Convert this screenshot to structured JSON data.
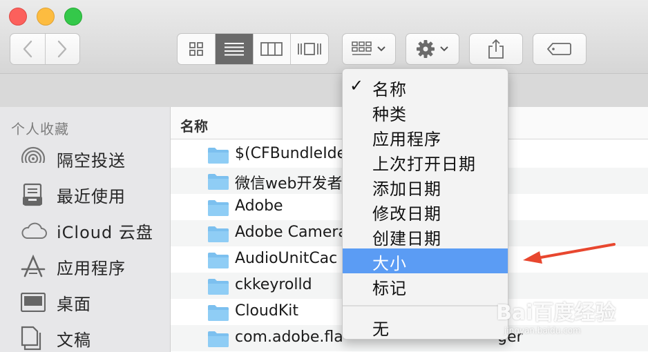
{
  "toolbar": {
    "view_modes": [
      "icon-view",
      "list-view",
      "column-view",
      "cover-flow-view"
    ],
    "active_view": "list-view"
  },
  "sidebar": {
    "heading": "个人收藏",
    "items": [
      {
        "label": "隔空投送",
        "icon": "airdrop-icon"
      },
      {
        "label": "最近使用",
        "icon": "recents-icon"
      },
      {
        "label": "iCloud 云盘",
        "icon": "cloud-icon"
      },
      {
        "label": "应用程序",
        "icon": "applications-icon"
      },
      {
        "label": "桌面",
        "icon": "desktop-icon"
      },
      {
        "label": "文稿",
        "icon": "documents-icon"
      }
    ]
  },
  "list": {
    "column_header": "名称",
    "rows": [
      {
        "name": "$(CFBundleIde"
      },
      {
        "name": "微信web开发者"
      },
      {
        "name": "Adobe"
      },
      {
        "name": "Adobe Camera"
      },
      {
        "name": "AudioUnitCac"
      },
      {
        "name": "ckkeyrolld"
      },
      {
        "name": "CloudKit"
      },
      {
        "name": "com.adobe.fla",
        "name_tail": "ger"
      }
    ]
  },
  "menu": {
    "checked_item": "名称",
    "highlighted_item": "大小",
    "items": [
      "名称",
      "种类",
      "应用程序",
      "上次打开日期",
      "添加日期",
      "修改日期",
      "创建日期",
      "大小",
      "标记"
    ],
    "bottom_item": "无"
  },
  "watermark": {
    "main": "Bai百度经验",
    "sub": "jingyan.baidu.com"
  },
  "colors": {
    "highlight": "#5b9cf4",
    "folder": "#7cc0ef",
    "arrow": "#e8472f"
  }
}
